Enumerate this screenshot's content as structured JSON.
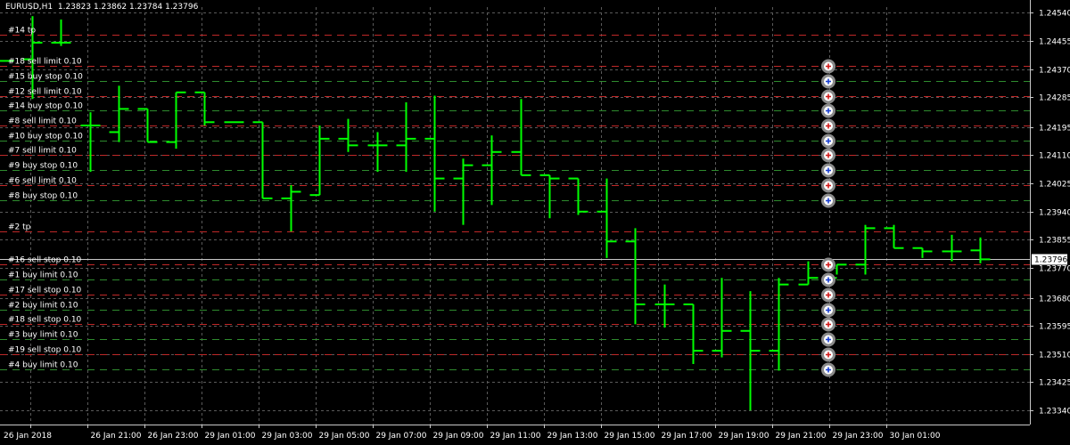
{
  "header": {
    "symbol": "EURUSD,H1",
    "ohlc": "1.23823 1.23862 1.23784 1.23796"
  },
  "colors": {
    "background": "#000000",
    "candle": "#00ff00",
    "grid": "#5a5a5a",
    "buy_line": "#2e8b2e",
    "sell_line": "#c02828",
    "current_price_line": "#c8c8c8",
    "price_tag_bg": "#ffffff"
  },
  "chart_data": {
    "type": "ohlc",
    "ylim": [
      1.233,
      1.2456
    ],
    "price_ticks": [
      "1.24540",
      "1.24455",
      "1.24370",
      "1.24285",
      "1.24195",
      "1.24110",
      "1.24025",
      "1.23940",
      "1.23855",
      "1.23770",
      "1.23680",
      "1.23595",
      "1.23510",
      "1.23425",
      "1.23340"
    ],
    "current_price": "1.23796",
    "time_labels": [
      "26 Jan 2018",
      "26 Jan 21:00",
      "26 Jan 23:00",
      "29 Jan 01:00",
      "29 Jan 03:00",
      "29 Jan 05:00",
      "29 Jan 07:00",
      "29 Jan 09:00",
      "29 Jan 11:00",
      "29 Jan 13:00",
      "29 Jan 15:00",
      "29 Jan 17:00",
      "29 Jan 19:00",
      "29 Jan 21:00",
      "29 Jan 23:00",
      "30 Jan 01:00"
    ],
    "bars": [
      {
        "o": 1.24395,
        "h": 1.24395,
        "l": 1.24395,
        "c": 1.24395
      },
      {
        "o": 1.244,
        "h": 1.2453,
        "l": 1.2428,
        "c": 1.2445
      },
      {
        "o": 1.2445,
        "h": 1.2452,
        "l": 1.2444,
        "c": 1.2445
      },
      {
        "o": 1.242,
        "h": 1.2424,
        "l": 1.2406,
        "c": 1.242
      },
      {
        "o": 1.2418,
        "h": 1.2432,
        "l": 1.2415,
        "c": 1.2425
      },
      {
        "o": 1.2425,
        "h": 1.2425,
        "l": 1.2415,
        "c": 1.2415
      },
      {
        "o": 1.2415,
        "h": 1.243,
        "l": 1.2413,
        "c": 1.243
      },
      {
        "o": 1.243,
        "h": 1.243,
        "l": 1.242,
        "c": 1.2421
      },
      {
        "o": 1.2421,
        "h": 1.2421,
        "l": 1.2421,
        "c": 1.2421
      },
      {
        "o": 1.2421,
        "h": 1.2421,
        "l": 1.2398,
        "c": 1.2398
      },
      {
        "o": 1.2398,
        "h": 1.2402,
        "l": 1.2388,
        "c": 1.24
      },
      {
        "o": 1.2399,
        "h": 1.242,
        "l": 1.2399,
        "c": 1.2416
      },
      {
        "o": 1.2416,
        "h": 1.2422,
        "l": 1.2412,
        "c": 1.2414
      },
      {
        "o": 1.2414,
        "h": 1.2418,
        "l": 1.2406,
        "c": 1.2414
      },
      {
        "o": 1.2414,
        "h": 1.2427,
        "l": 1.2406,
        "c": 1.2416
      },
      {
        "o": 1.2416,
        "h": 1.2429,
        "l": 1.2394,
        "c": 1.2404
      },
      {
        "o": 1.2404,
        "h": 1.241,
        "l": 1.239,
        "c": 1.2408
      },
      {
        "o": 1.2408,
        "h": 1.2417,
        "l": 1.2396,
        "c": 1.2412
      },
      {
        "o": 1.2412,
        "h": 1.2428,
        "l": 1.2405,
        "c": 1.2405
      },
      {
        "o": 1.2405,
        "h": 1.2405,
        "l": 1.2392,
        "c": 1.2404
      },
      {
        "o": 1.2404,
        "h": 1.2404,
        "l": 1.2393,
        "c": 1.2394
      },
      {
        "o": 1.2394,
        "h": 1.2404,
        "l": 1.238,
        "c": 1.2385
      },
      {
        "o": 1.2385,
        "h": 1.2389,
        "l": 1.236,
        "c": 1.2366
      },
      {
        "o": 1.2366,
        "h": 1.2372,
        "l": 1.2359,
        "c": 1.2366
      },
      {
        "o": 1.2366,
        "h": 1.2366,
        "l": 1.2348,
        "c": 1.2352
      },
      {
        "o": 1.2352,
        "h": 1.2374,
        "l": 1.235,
        "c": 1.2358
      },
      {
        "o": 1.2358,
        "h": 1.237,
        "l": 1.2334,
        "c": 1.2352
      },
      {
        "o": 1.2352,
        "h": 1.2374,
        "l": 1.2346,
        "c": 1.2372
      },
      {
        "o": 1.2372,
        "h": 1.2379,
        "l": 1.2372,
        "c": 1.2374
      },
      {
        "o": 1.2374,
        "h": 1.2378,
        "l": 1.2375,
        "c": 1.2378
      },
      {
        "o": 1.2378,
        "h": 1.239,
        "l": 1.2375,
        "c": 1.2389
      },
      {
        "o": 1.2389,
        "h": 1.239,
        "l": 1.2383,
        "c": 1.2383
      },
      {
        "o": 1.2383,
        "h": 1.2383,
        "l": 1.238,
        "c": 1.2382
      },
      {
        "o": 1.2382,
        "h": 1.2387,
        "l": 1.2379,
        "c": 1.2382
      },
      {
        "o": 1.23823,
        "h": 1.23862,
        "l": 1.23784,
        "c": 1.23796
      }
    ]
  },
  "orders": [
    {
      "label": "#14 tp",
      "price": 1.24475,
      "kind": "sell",
      "marker": false
    },
    {
      "label": "#18 sell limit 0.10",
      "price": 1.2438,
      "kind": "sell",
      "marker": true
    },
    {
      "label": "#15 buy stop 0.10",
      "price": 1.24335,
      "kind": "buy",
      "marker": true
    },
    {
      "label": "#12 sell limit 0.10",
      "price": 1.2429,
      "kind": "sell",
      "marker": true
    },
    {
      "label": "#14 buy stop 0.10",
      "price": 1.24245,
      "kind": "buy",
      "marker": true
    },
    {
      "label": "#8 sell limit 0.10",
      "price": 1.242,
      "kind": "sell",
      "marker": true
    },
    {
      "label": "#10 buy stop 0.10",
      "price": 1.24155,
      "kind": "buy",
      "marker": true
    },
    {
      "label": "#7 sell limit 0.10",
      "price": 1.2411,
      "kind": "sell",
      "marker": true
    },
    {
      "label": "#9 buy stop 0.10",
      "price": 1.24065,
      "kind": "buy",
      "marker": true
    },
    {
      "label": "#6 sell limit 0.10",
      "price": 1.2402,
      "kind": "sell",
      "marker": true
    },
    {
      "label": "#8 buy stop 0.10",
      "price": 1.23975,
      "kind": "buy",
      "marker": true
    },
    {
      "label": "#2 tp",
      "price": 1.2388,
      "kind": "sell",
      "marker": false
    },
    {
      "label": "#16 sell stop 0.10",
      "price": 1.2378,
      "kind": "sell",
      "marker": true
    },
    {
      "label": "#1 buy limit 0.10",
      "price": 1.23735,
      "kind": "buy",
      "marker": true
    },
    {
      "label": "#17 sell stop 0.10",
      "price": 1.2369,
      "kind": "sell",
      "marker": true
    },
    {
      "label": "#2 buy limit 0.10",
      "price": 1.23645,
      "kind": "buy",
      "marker": true
    },
    {
      "label": "#18 sell stop 0.10",
      "price": 1.236,
      "kind": "sell",
      "marker": true
    },
    {
      "label": "#3 buy limit 0.10",
      "price": 1.23555,
      "kind": "buy",
      "marker": true
    },
    {
      "label": "#19 sell stop 0.10",
      "price": 1.2351,
      "kind": "sell",
      "marker": true
    },
    {
      "label": "#4 buy limit 0.10",
      "price": 1.23465,
      "kind": "buy",
      "marker": true
    }
  ]
}
